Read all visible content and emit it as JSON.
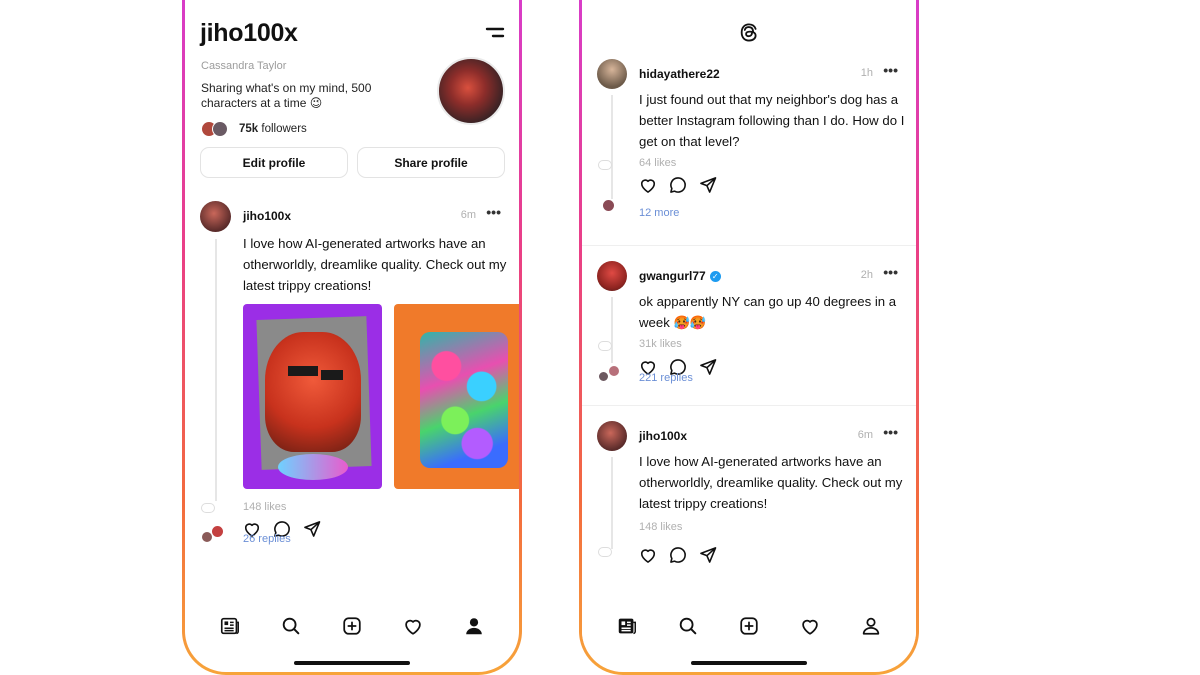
{
  "profile_screen": {
    "username": "jiho100x",
    "real_name": "Cassandra Taylor",
    "bio": "Sharing what's on my mind, 500 characters at a time 😉",
    "followers_count": "75k",
    "followers_label": "followers",
    "edit_profile_label": "Edit profile",
    "share_profile_label": "Share profile",
    "post": {
      "username": "jiho100x",
      "time": "6m",
      "more": "•••",
      "text": "I love how AI-generated artworks have an otherworldly, dreamlike quality. Check out my latest trippy creations!",
      "likes": "148 likes",
      "replies": "26 replies"
    }
  },
  "feed_screen": {
    "posts": [
      {
        "username": "hidayathere22",
        "time": "1h",
        "more": "•••",
        "verified": false,
        "text": "I just found out that my neighbor's dog has a better Instagram following than I do. How do I get on that level?",
        "likes": "64 likes",
        "replies": "12 more"
      },
      {
        "username": "gwangurl77",
        "time": "2h",
        "more": "•••",
        "verified": true,
        "text": "ok apparently NY can go up 40 degrees in a week 🥵🥵",
        "likes": "31k likes",
        "replies": "221 replies"
      },
      {
        "username": "jiho100x",
        "time": "6m",
        "more": "•••",
        "verified": false,
        "text": "I love how AI-generated artworks have an otherworldly, dreamlike quality. Check out my latest trippy creations!",
        "likes": "148 likes"
      }
    ]
  },
  "tab_icons": [
    "feed-icon",
    "search-icon",
    "compose-icon",
    "heart-icon",
    "profile-icon"
  ],
  "colors": {
    "frame_gradient": [
      "#d63bd0",
      "#ea3f86",
      "#f36a3e",
      "#f7a43a"
    ],
    "link_blue": "#6b8fd6",
    "muted_gray": "#b0b0b0",
    "verified_blue": "#1d9bf0"
  }
}
